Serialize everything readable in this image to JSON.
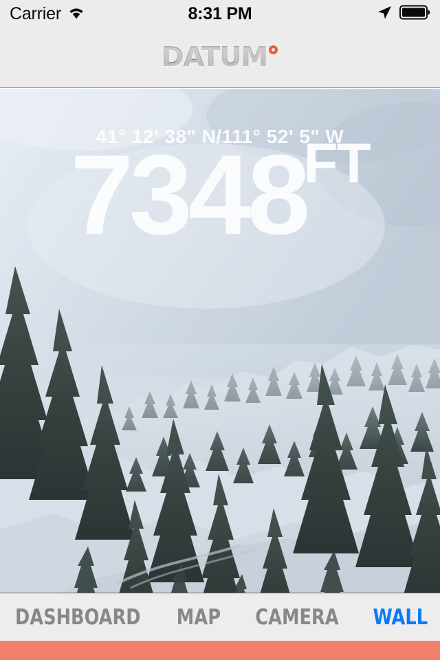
{
  "status_bar": {
    "carrier": "Carrier",
    "wifi_icon": "wifi-icon",
    "time": "8:31 PM",
    "location_icon": "location-arrow-icon",
    "battery_icon": "battery-full-icon"
  },
  "header": {
    "logo_text": "DATUM",
    "logo_mark": "degree-ring",
    "logo_color": "#6e6e6e",
    "logo_accent_color": "#ef5b3c",
    "background": "#ececec"
  },
  "wall": {
    "coordinates": "41° 12' 38\" N/111° 52' 5\" W",
    "elevation_value": "7348",
    "elevation_unit": "FT",
    "photo_description": "snow-covered mountain slope with dark evergreen pine trees under misty overcast sky"
  },
  "tab_bar": {
    "background": "#ededed",
    "inactive_color": "#888888",
    "active_color": "#0a7af5",
    "tabs": [
      {
        "label": "DASHBOARD",
        "active": false
      },
      {
        "label": "MAP",
        "active": false
      },
      {
        "label": "CAMERA",
        "active": false
      },
      {
        "label": "WALL",
        "active": true
      }
    ]
  },
  "accent_bar": {
    "color": "#f0806b"
  }
}
